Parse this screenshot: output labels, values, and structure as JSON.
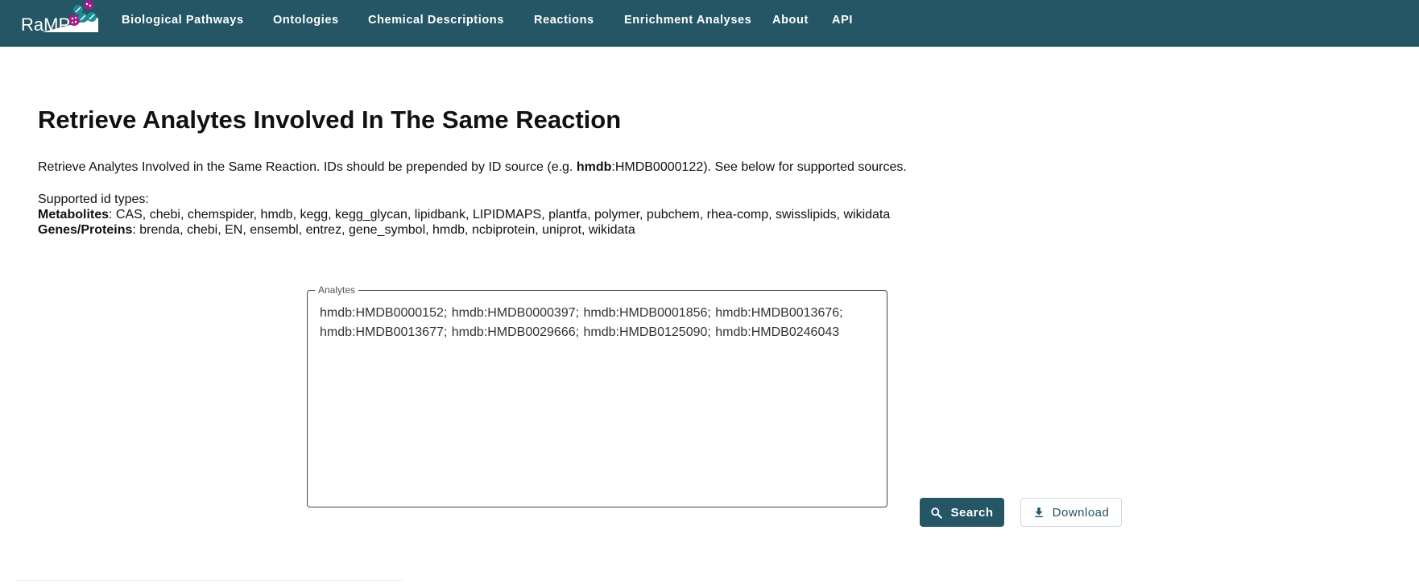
{
  "header": {
    "logo_text": "RaMP",
    "nav": [
      {
        "label": "Biological Pathways"
      },
      {
        "label": "Ontologies"
      },
      {
        "label": "Chemical Descriptions"
      },
      {
        "label": "Reactions"
      },
      {
        "label": "Enrichment Analyses"
      },
      {
        "label": "About"
      },
      {
        "label": "API"
      }
    ],
    "colors": {
      "bar": "#255665",
      "logo_magenta": "#a21c8c",
      "logo_teal": "#1c8c96"
    }
  },
  "main": {
    "title": "Retrieve Analytes Involved In The Same Reaction",
    "description": {
      "before": "Retrieve Analytes Involved in the Same Reaction. IDs should be prepended by ID source (e.g. ",
      "bold": "hmdb",
      "after": ":HMDB0000122). See below for supported sources."
    },
    "supported_heading": "Supported id types:",
    "metabolites": {
      "label": "Metabolites",
      "values": ": CAS, chebi, chemspider, hmdb, kegg, kegg_glycan, lipidbank, LIPIDMAPS, plantfa, polymer, pubchem, rhea-comp, swisslipids, wikidata"
    },
    "genes": {
      "label": "Genes/Proteins",
      "values": ": brenda, chebi, EN, ensembl, entrez, gene_symbol, hmdb, ncbiprotein, uniprot, wikidata"
    },
    "analytes_field": {
      "label": "Analytes",
      "value": "hmdb:HMDB0000152; hmdb:HMDB0000397; hmdb:HMDB0001856; hmdb:HMDB0013676; hmdb:HMDB0013677; hmdb:HMDB0029666; hmdb:HMDB0125090; hmdb:HMDB0246043"
    },
    "buttons": {
      "search": {
        "label": "Search",
        "icon": "search-icon"
      },
      "download": {
        "label": "Download",
        "icon": "download-icon"
      }
    }
  }
}
